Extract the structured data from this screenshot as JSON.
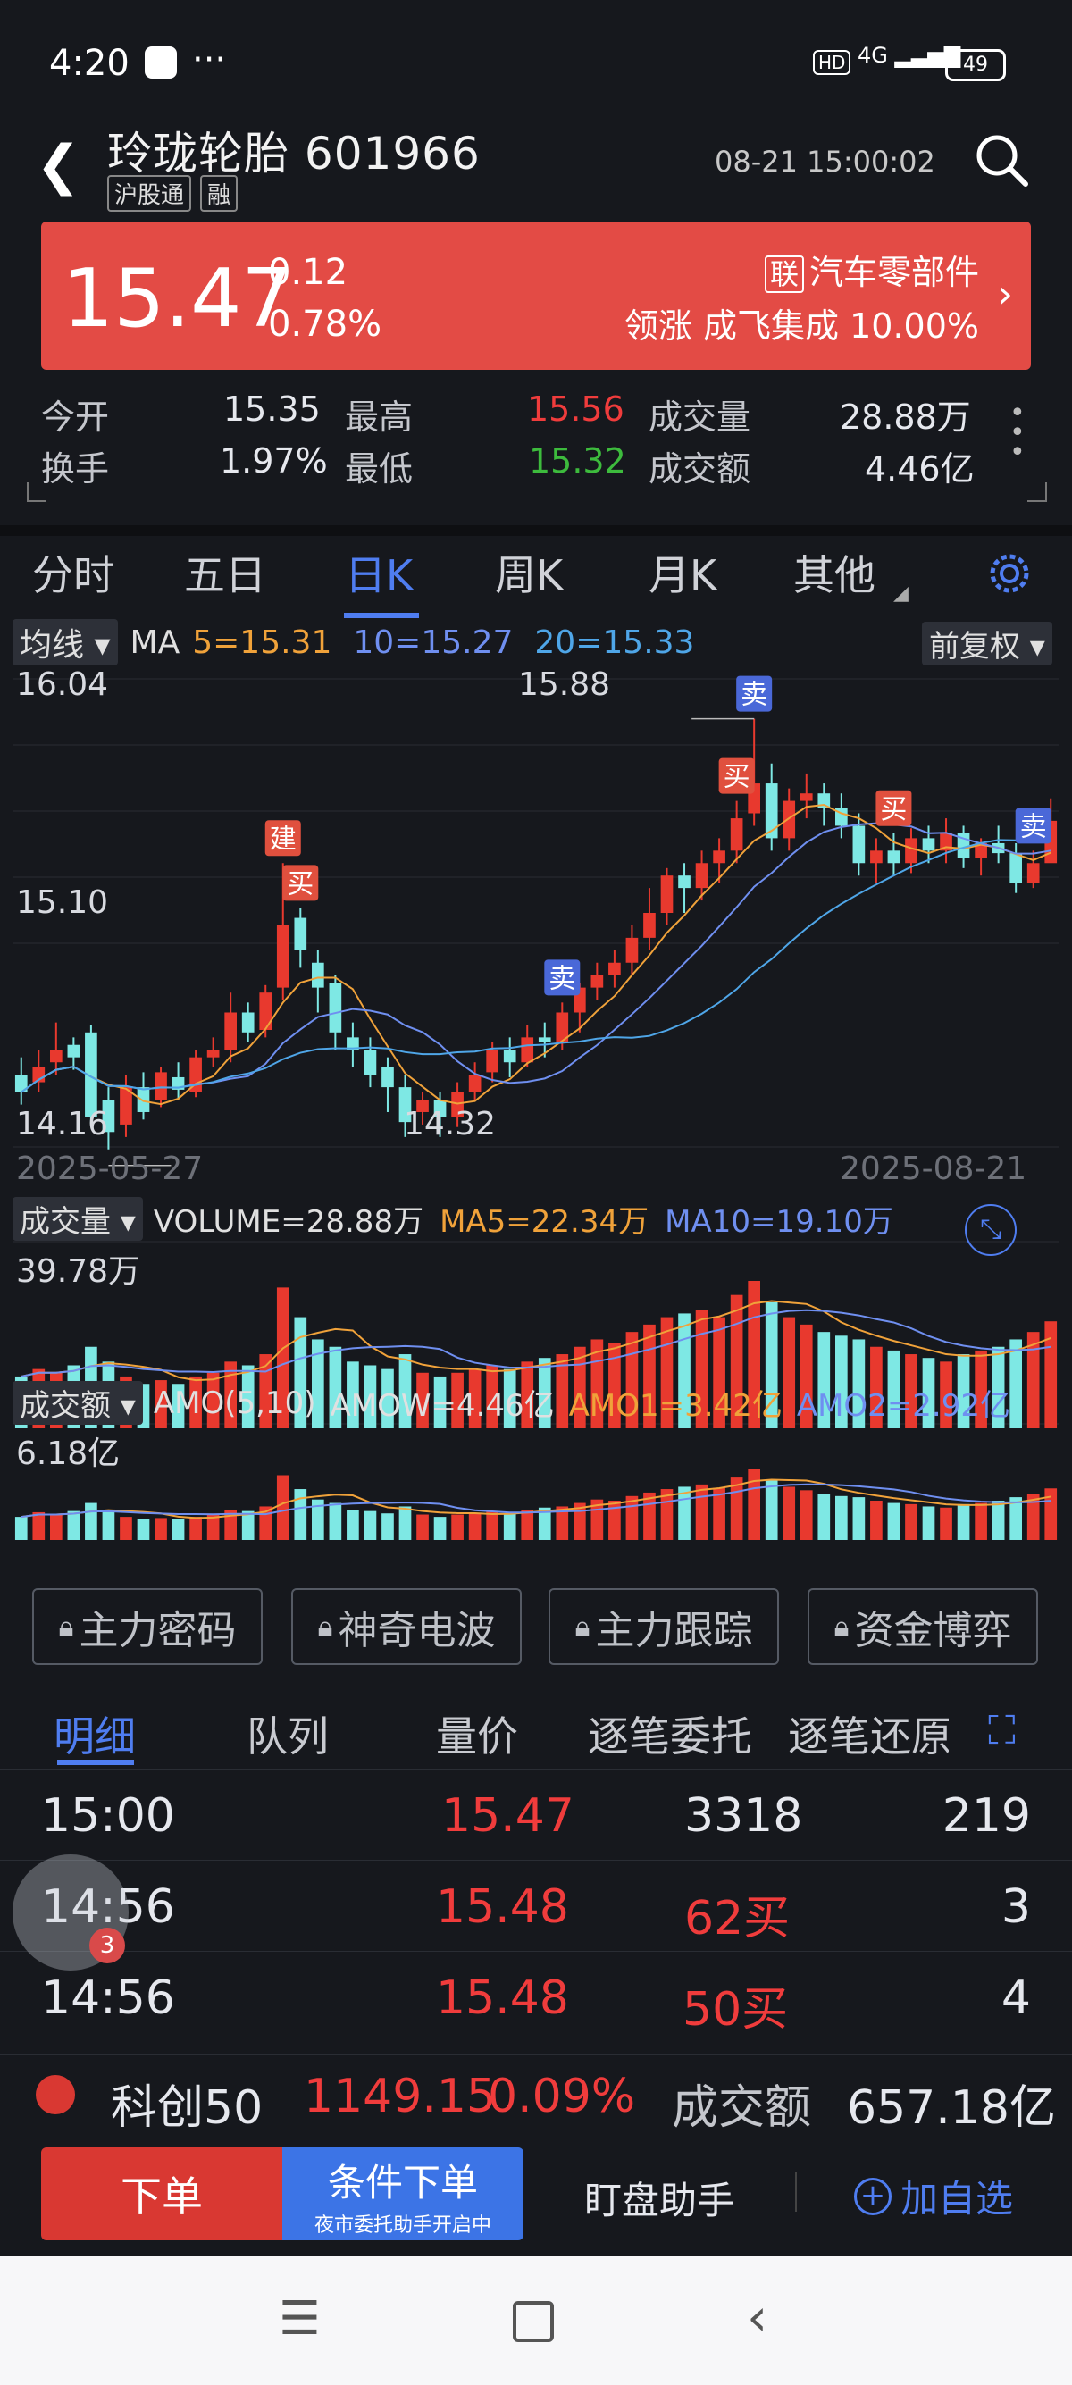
{
  "status_bar": {
    "time": "4:20",
    "more": "···",
    "hd": "HD",
    "network": "4G",
    "battery": "49"
  },
  "header": {
    "name": "玲珑轮胎",
    "code": "601966",
    "tags": [
      "沪股通",
      "融"
    ],
    "datetime": "08-21 15:00:02"
  },
  "quote": {
    "price": "15.47",
    "change": "0.12",
    "change_pct": "0.78%",
    "sector_icon": "联",
    "sector": "汽车零部件",
    "leader_line": "领涨 成飞集成 10.00%"
  },
  "stats": {
    "open_label": "今开",
    "open": "15.35",
    "high_label": "最高",
    "high": "15.56",
    "volume_label": "成交量",
    "volume": "28.88万",
    "turnover_label": "换手",
    "turnover": "1.97%",
    "low_label": "最低",
    "low": "15.32",
    "amount_label": "成交额",
    "amount": "4.46亿"
  },
  "tabs": [
    "分时",
    "五日",
    "日K",
    "周K",
    "月K",
    "其他"
  ],
  "active_tab": "日K",
  "chart_labels": {
    "ma_selector": "均线",
    "ma_title": "MA",
    "ma5": "5=15.31",
    "ma10": "10=15.27",
    "ma20": "20=15.33",
    "adjust": "前复权",
    "y_top": "16.04",
    "y_mid": "15.10",
    "y_bot": "14.16",
    "peak_label": "15.88",
    "trough_label": "14.32",
    "date_start": "2025-05-27",
    "date_end": "2025-08-21",
    "vol_selector": "成交量",
    "vol_value": "VOLUME=28.88万",
    "vol_ma5": "MA5=22.34万",
    "vol_ma10": "MA10=19.10万",
    "vol_max": "39.78万",
    "amo_selector": "成交额",
    "amo_title": "AMO(5,10)",
    "amo_value": "AMOW=4.46亿",
    "amo1": "AMO1=3.42亿",
    "amo2": "AMO2=2.92亿",
    "amo_max": "6.18亿",
    "sig_buy": "买",
    "sig_sell": "卖",
    "sig_build": "建"
  },
  "colors": {
    "up": "#e8392e",
    "down": "#7ee8e4",
    "ma5": "#f0a23a",
    "ma10": "#6f8ff0",
    "ma20": "#4fa6e8",
    "accent": "#4f7df0"
  },
  "chart_data": {
    "type": "candlestick",
    "date_start": "2025-05-27",
    "date_end": "2025-08-21",
    "ylim": [
      14.16,
      16.04
    ],
    "high_mark": 15.88,
    "low_mark": 14.32,
    "candles": [
      [
        14.45,
        14.38,
        14.52,
        14.33
      ],
      [
        14.42,
        14.48,
        14.55,
        14.38
      ],
      [
        14.5,
        14.55,
        14.66,
        14.45
      ],
      [
        14.57,
        14.52,
        14.6,
        14.47
      ],
      [
        14.62,
        14.28,
        14.65,
        14.25
      ],
      [
        14.35,
        14.22,
        14.4,
        14.15
      ],
      [
        14.25,
        14.4,
        14.45,
        14.2
      ],
      [
        14.4,
        14.3,
        14.46,
        14.27
      ],
      [
        14.35,
        14.46,
        14.48,
        14.32
      ],
      [
        14.44,
        14.39,
        14.5,
        14.35
      ],
      [
        14.38,
        14.52,
        14.55,
        14.36
      ],
      [
        14.52,
        14.55,
        14.6,
        14.48
      ],
      [
        14.55,
        14.7,
        14.78,
        14.5
      ],
      [
        14.7,
        14.62,
        14.74,
        14.58
      ],
      [
        14.63,
        14.78,
        14.81,
        14.6
      ],
      [
        14.8,
        15.05,
        15.3,
        14.75
      ],
      [
        15.08,
        14.95,
        15.12,
        14.88
      ],
      [
        14.9,
        14.8,
        14.95,
        14.7
      ],
      [
        14.82,
        14.62,
        14.85,
        14.55
      ],
      [
        14.6,
        14.55,
        14.66,
        14.48
      ],
      [
        14.55,
        14.45,
        14.6,
        14.4
      ],
      [
        14.48,
        14.4,
        14.52,
        14.3
      ],
      [
        14.4,
        14.26,
        14.45,
        14.2
      ],
      [
        14.3,
        14.35,
        14.38,
        14.25
      ],
      [
        14.35,
        14.28,
        14.38,
        14.2
      ],
      [
        14.28,
        14.38,
        14.42,
        14.24
      ],
      [
        14.38,
        14.45,
        14.5,
        14.35
      ],
      [
        14.46,
        14.55,
        14.58,
        14.42
      ],
      [
        14.55,
        14.5,
        14.6,
        14.44
      ],
      [
        14.5,
        14.6,
        14.65,
        14.48
      ],
      [
        14.6,
        14.58,
        14.66,
        14.52
      ],
      [
        14.58,
        14.7,
        14.74,
        14.55
      ],
      [
        14.7,
        14.8,
        14.82,
        14.62
      ],
      [
        14.8,
        14.85,
        14.9,
        14.75
      ],
      [
        14.85,
        14.9,
        14.95,
        14.8
      ],
      [
        14.9,
        15.0,
        15.05,
        14.85
      ],
      [
        15.0,
        15.1,
        15.2,
        14.95
      ],
      [
        15.1,
        15.25,
        15.28,
        15.05
      ],
      [
        15.25,
        15.2,
        15.3,
        15.1
      ],
      [
        15.2,
        15.3,
        15.35,
        15.15
      ],
      [
        15.3,
        15.35,
        15.4,
        15.22
      ],
      [
        15.35,
        15.48,
        15.55,
        15.3
      ],
      [
        15.5,
        15.62,
        15.88,
        15.45
      ],
      [
        15.62,
        15.4,
        15.7,
        15.35
      ],
      [
        15.4,
        15.55,
        15.6,
        15.35
      ],
      [
        15.55,
        15.58,
        15.66,
        15.48
      ],
      [
        15.58,
        15.52,
        15.62,
        15.45
      ],
      [
        15.52,
        15.45,
        15.58,
        15.4
      ],
      [
        15.45,
        15.3,
        15.5,
        15.25
      ],
      [
        15.3,
        15.35,
        15.4,
        15.22
      ],
      [
        15.35,
        15.3,
        15.42,
        15.25
      ],
      [
        15.3,
        15.4,
        15.44,
        15.26
      ],
      [
        15.4,
        15.35,
        15.45,
        15.3
      ],
      [
        15.35,
        15.42,
        15.48,
        15.3
      ],
      [
        15.42,
        15.32,
        15.45,
        15.28
      ],
      [
        15.32,
        15.38,
        15.4,
        15.25
      ],
      [
        15.38,
        15.34,
        15.45,
        15.3
      ],
      [
        15.34,
        15.22,
        15.38,
        15.18
      ],
      [
        15.22,
        15.3,
        15.35,
        15.2
      ],
      [
        15.3,
        15.47,
        15.56,
        15.32
      ]
    ],
    "signals": [
      {
        "index": 15,
        "type": "建"
      },
      {
        "index": 16,
        "type": "买"
      },
      {
        "index": 31,
        "type": "卖"
      },
      {
        "index": 41,
        "type": "买"
      },
      {
        "index": 42,
        "type": "卖"
      },
      {
        "index": 50,
        "type": "买"
      },
      {
        "index": 58,
        "type": "卖"
      }
    ],
    "volume_max": 39.78,
    "volume": [
      14,
      16,
      15,
      17,
      22,
      18,
      14,
      12,
      13,
      12,
      14,
      15,
      18,
      17,
      20,
      38,
      30,
      24,
      22,
      18,
      17,
      16,
      20,
      15,
      14,
      15,
      16,
      17,
      16,
      18,
      19,
      20,
      22,
      24,
      23,
      26,
      28,
      30,
      31,
      32,
      30,
      36,
      39.78,
      34,
      30,
      28,
      26,
      25,
      24,
      22,
      21,
      20,
      19,
      18,
      20,
      21,
      22,
      24,
      26,
      28.88
    ],
    "amount_max": 6.18,
    "amount": [
      2.0,
      2.4,
      2.2,
      2.5,
      3.2,
      2.6,
      2.0,
      1.8,
      1.9,
      1.8,
      2.0,
      2.2,
      2.6,
      2.5,
      2.9,
      5.6,
      4.4,
      3.5,
      3.2,
      2.6,
      2.5,
      2.3,
      2.9,
      2.2,
      2.0,
      2.2,
      2.3,
      2.5,
      2.3,
      2.6,
      2.8,
      2.9,
      3.2,
      3.5,
      3.4,
      3.8,
      4.1,
      4.4,
      4.6,
      4.8,
      4.5,
      5.4,
      6.18,
      5.2,
      4.6,
      4.3,
      4.0,
      3.8,
      3.7,
      3.4,
      3.2,
      3.1,
      2.9,
      2.8,
      3.1,
      3.2,
      3.4,
      3.7,
      4.0,
      4.46
    ]
  },
  "lock_buttons": [
    "主力密码",
    "神奇电波",
    "主力跟踪",
    "资金博弈"
  ],
  "detail_tabs": [
    "明细",
    "队列",
    "量价",
    "逐笔委托",
    "逐笔还原"
  ],
  "trades": [
    {
      "time": "15:00",
      "price": "15.47",
      "vol": "3318",
      "count": "219"
    },
    {
      "time": "14:56",
      "price": "15.48",
      "vol": "62买",
      "count": "3"
    },
    {
      "time": "14:56",
      "price": "15.48",
      "vol": "50买",
      "count": "4"
    }
  ],
  "ticker": {
    "name": "科创50",
    "value": "1149.15",
    "pct": "0.09%",
    "amount_label": "成交额",
    "amount": "657.18亿"
  },
  "actions": {
    "order": "下单",
    "cond_order": "条件下单",
    "cond_sub": "夜市委托助手开启中",
    "monitor": "盯盘助手",
    "add_watch": "加自选"
  },
  "float_badge": "3"
}
